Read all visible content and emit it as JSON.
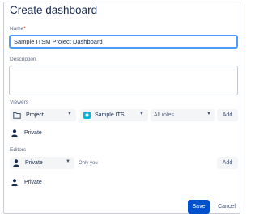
{
  "dialog": {
    "title": "Create dashboard"
  },
  "name": {
    "label": "Name",
    "required_mark": "*",
    "value": "Sample ITSM Project Dashboard"
  },
  "description": {
    "label": "Description",
    "value": ""
  },
  "viewers": {
    "label": "Viewers",
    "type_select": "Project",
    "project_select": "Sample ITS...",
    "role_select": "All roles",
    "add_label": "Add",
    "entries": [
      {
        "label": "Private",
        "icon": "user-icon"
      }
    ]
  },
  "editors": {
    "label": "Editors",
    "type_select": "Private",
    "hint": "Only you",
    "add_label": "Add",
    "entries": [
      {
        "label": "Private",
        "icon": "user-icon"
      }
    ]
  },
  "footer": {
    "save_label": "Save",
    "cancel_label": "Cancel"
  },
  "colors": {
    "primary": "#0052cc",
    "focus": "#4c9aff",
    "required": "#de350b",
    "project_icon": "#00b8d9"
  }
}
